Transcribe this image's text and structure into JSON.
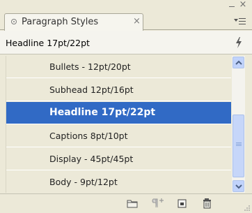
{
  "panel": {
    "tab_label": "Paragraph Styles",
    "tab_close_glyph": "×",
    "close_glyph": "×",
    "current_style": "Headline 17pt/22pt"
  },
  "styles": [
    {
      "label": "Bullets - 12pt/20pt",
      "selected": false
    },
    {
      "label": "Subhead 12pt/16pt",
      "selected": false
    },
    {
      "label": "Headline 17pt/22pt",
      "selected": true
    },
    {
      "label": "Captions 8pt/10pt",
      "selected": false
    },
    {
      "label": "Display - 45pt/45pt",
      "selected": false
    },
    {
      "label": "Body - 9pt/12pt",
      "selected": false
    }
  ],
  "toolbar": {
    "icons": [
      "folder-icon",
      "clear-overrides-icon",
      "new-style-icon",
      "trash-icon"
    ]
  },
  "colors": {
    "selection": "#316ac5",
    "panel_bg": "#ece9d8",
    "scrollbar": "#c1d3fb"
  }
}
